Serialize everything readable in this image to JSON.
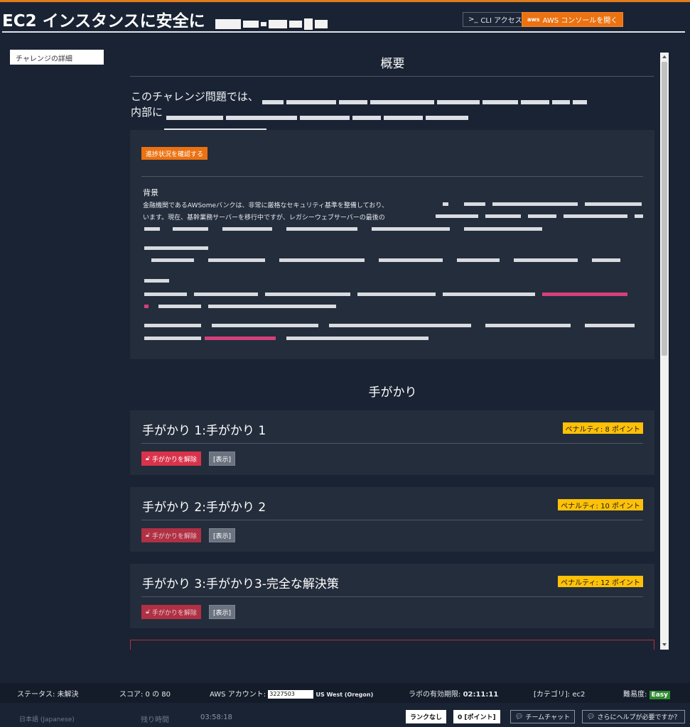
{
  "header": {
    "title": "EC2 インスタンスに安全に",
    "cli_label": "CLI アクセス",
    "console_label": "AWS コンソールを開く",
    "aws_logo": "aws"
  },
  "sidebar": {
    "items": [
      {
        "label": "チャレンジの詳細"
      }
    ]
  },
  "overview": {
    "title": "概要",
    "intro_line1": "このチャレンジ問題では、",
    "intro_line2": "内部に",
    "progress_button": "進捗状況を確認する",
    "background_title": "背景",
    "background_line1": "金融機関であるAWSomeバンクは、非常に厳格なセキュリティ基準を整備しており、",
    "background_line2": "います。現在、基幹業務サーバーを移行中ですが、レガシーウェブサーバーの最後の"
  },
  "hints": {
    "title": "手がかり",
    "unlock_label": "手がかりを解除",
    "show_label": "[表示]",
    "items": [
      {
        "title": "手がかり 1:手がかり 1",
        "penalty": "ペナルティ: 8 ポイント"
      },
      {
        "title": "手がかり 2:手がかり 2",
        "penalty": "ペナルティ: 10 ポイント"
      },
      {
        "title": "手がかり 3:手がかり3-完全な解決策",
        "penalty": "ペナルティ: 12 ポイント"
      }
    ]
  },
  "status_bar": {
    "status": "ステータス: 未解決",
    "score": "スコア: 0 の 80",
    "account_label": "AWS アカウント:",
    "account_value": "3227503",
    "region": "US West (Oregon)",
    "lab_expiry_label": "ラボの有効期限:",
    "lab_expiry_value": "02:11:11",
    "category": "[カテゴリ]: ec2",
    "difficulty_label": "難易度:",
    "difficulty_value": "Easy"
  },
  "bottom_bar": {
    "language": "日本語 (Japanese)",
    "remaining_label": "残り時間",
    "remaining_value": "03:58:18",
    "rank_label": "ランクなし",
    "points_label": "0 [ポイント]",
    "team_chat_label": "チームチャット",
    "help_label": "さらにヘルプが必要ですか？"
  },
  "colors": {
    "accent": "#ec7211",
    "penalty": "#ffc107",
    "unlock": "#d9334b",
    "easy": "#2e8b2e",
    "background": "#1a2333"
  }
}
